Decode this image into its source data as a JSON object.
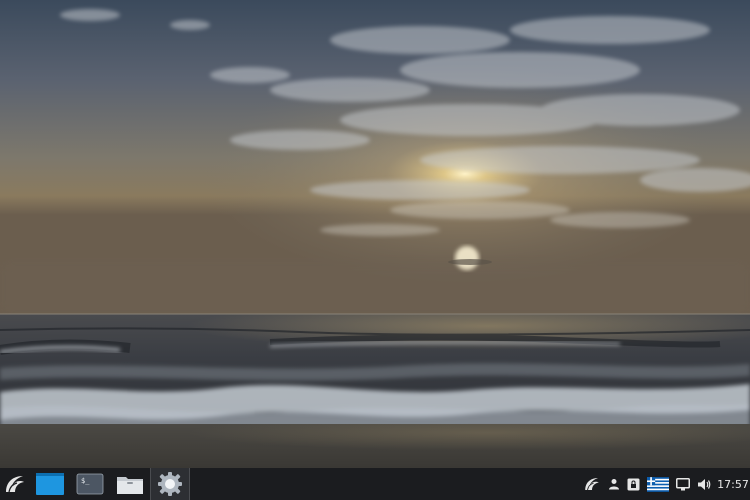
{
  "wallpaper": {
    "description_colors": {
      "sky_top": "#3e4d5f",
      "sky_mid": "#7d7a70",
      "horizon_glow": "#d9c48a",
      "sea": "#3a3e44",
      "foam": "#c9d0d8",
      "sand": "#4a4640"
    }
  },
  "taskbar": {
    "background": "#1b1c1f",
    "launchers": [
      {
        "name": "start-menu-button",
        "icon": "logo-swirl-icon"
      },
      {
        "name": "show-desktop-button",
        "icon": "desktop-window-icon",
        "color": "#2a9fe6"
      },
      {
        "name": "terminal-button",
        "icon": "terminal-icon"
      },
      {
        "name": "file-manager-button",
        "icon": "folder-icon"
      },
      {
        "name": "settings-button",
        "icon": "gear-icon",
        "active": true
      }
    ],
    "tray": {
      "items": [
        {
          "name": "tray-logo",
          "icon": "logo-swirl-icon"
        },
        {
          "name": "tray-user",
          "icon": "user-icon"
        },
        {
          "name": "tray-keyring",
          "icon": "lock-icon"
        },
        {
          "name": "tray-keyboard-layout",
          "icon": "greek-flag-icon"
        },
        {
          "name": "tray-display",
          "icon": "monitor-icon"
        },
        {
          "name": "tray-volume",
          "icon": "speaker-icon"
        }
      ],
      "clock": "17:57"
    }
  }
}
